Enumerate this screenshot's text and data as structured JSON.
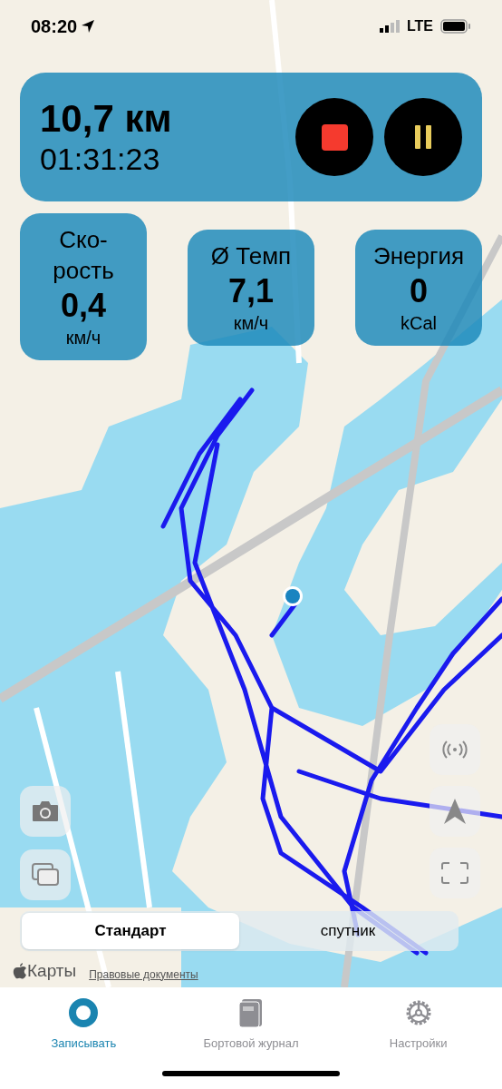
{
  "status_bar": {
    "time": "08:20",
    "network": "LTE"
  },
  "session": {
    "distance": "10,7 км",
    "elapsed": "01:31:23"
  },
  "controls": [
    {
      "kind": "stop"
    },
    {
      "kind": "pause"
    }
  ],
  "stats": [
    {
      "label": "Ско-рость",
      "value": "0,4",
      "unit": "км/ч"
    },
    {
      "label": "Ø Темп",
      "value": "7,1",
      "unit": "км/ч"
    },
    {
      "label": "Энергия",
      "value": "0",
      "unit": "kCal"
    }
  ],
  "map_type": [
    {
      "label": "Стандарт",
      "selected": true
    },
    {
      "label": "спутник",
      "selected": false
    }
  ],
  "attribution": {
    "logo": "Карты",
    "legal": "Правовые документы"
  },
  "tab_bar": [
    {
      "label": "Записывать",
      "kind": "record",
      "selected": true
    },
    {
      "label": "Бортовой журнал",
      "kind": "logbook",
      "selected": false
    },
    {
      "label": "Настройки",
      "kind": "settings",
      "selected": false
    }
  ]
}
